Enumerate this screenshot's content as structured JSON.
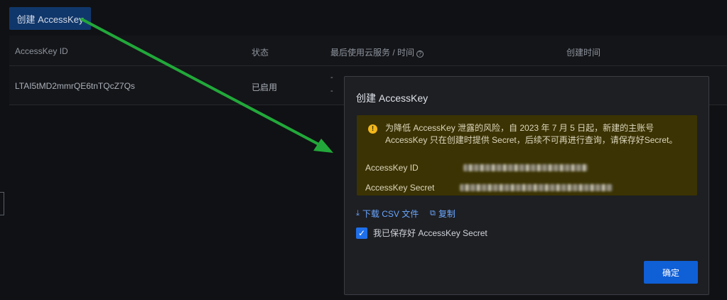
{
  "toolbar": {
    "create_label": "创建 AccessKey"
  },
  "table": {
    "headers": [
      "AccessKey ID",
      "状态",
      "最后使用云服务 / 时间",
      "创建时间"
    ],
    "rows": [
      {
        "id": "LTAI5tMD2mmrQE6tnTQcZ7Qs",
        "status": "已启用",
        "last_used_1": "-",
        "last_used_2": "-"
      }
    ]
  },
  "modal": {
    "title": "创建 AccessKey",
    "warning_line1": "为降低 AccessKey 泄露的风险，自 2023 年 7 月 5 日起，新建的主账号",
    "warning_line2": "AccessKey 只在创建时提供 Secret，后续不可再进行查询，请保存好Secret。",
    "id_label": "AccessKey ID",
    "secret_label": "AccessKey Secret",
    "download_label": "下载 CSV 文件",
    "copy_label": "复制",
    "checkbox_label": "我已保存好 AccessKey Secret",
    "checkbox_checked": true,
    "confirm_label": "确定"
  },
  "icons": {
    "help": "help-circle-icon",
    "warning": "warning-icon",
    "download": "download-icon",
    "copy": "copy-icon",
    "check": "check-icon"
  },
  "colors": {
    "primary": "#0f5fd6",
    "warning_bg": "#3b3303",
    "warning_icon": "#f2b71b",
    "link": "#6aa7ff",
    "annotation_arrow": "#22a83a"
  }
}
